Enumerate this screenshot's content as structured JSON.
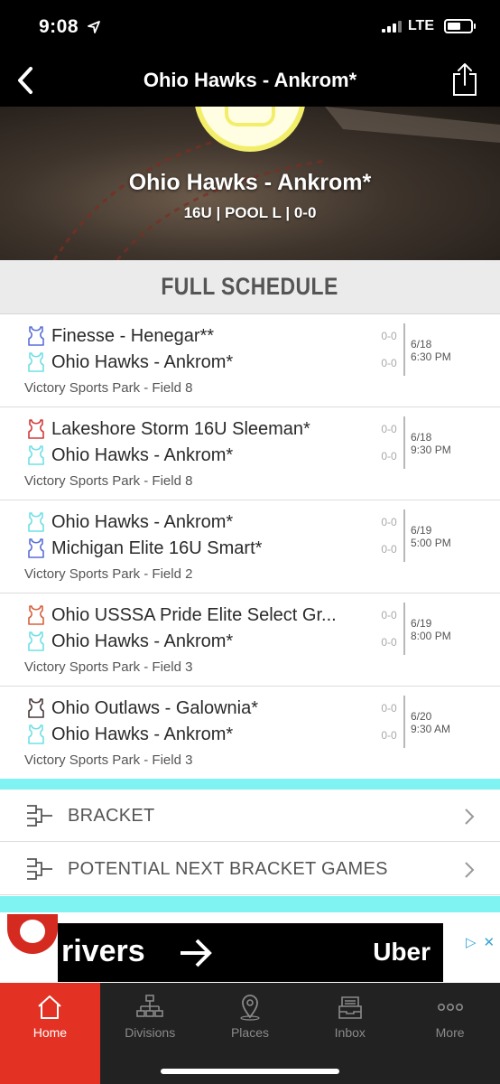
{
  "status_bar": {
    "time": "9:08",
    "network": "LTE"
  },
  "nav": {
    "title": "Ohio Hawks - Ankrom*"
  },
  "hero": {
    "team_name": "Ohio Hawks - Ankrom*",
    "meta": "16U | POOL L | 0-0"
  },
  "schedule": {
    "heading": "FULL SCHEDULE",
    "games": [
      {
        "team1": {
          "name": "Finesse - Henegar**",
          "score": "0-0",
          "jersey_color": "#5a6fd6"
        },
        "team2": {
          "name": "Ohio Hawks - Ankrom*",
          "score": "0-0",
          "jersey_color": "#6fe0e6"
        },
        "date": "6/18",
        "time": "6:30 PM",
        "venue": "Victory Sports Park - Field 8"
      },
      {
        "team1": {
          "name": "Lakeshore Storm 16U Sleeman*",
          "score": "0-0",
          "jersey_color": "#d23a3a"
        },
        "team2": {
          "name": "Ohio Hawks - Ankrom*",
          "score": "0-0",
          "jersey_color": "#6fe0e6"
        },
        "date": "6/18",
        "time": "9:30 PM",
        "venue": "Victory Sports Park - Field 8"
      },
      {
        "team1": {
          "name": "Ohio Hawks - Ankrom*",
          "score": "0-0",
          "jersey_color": "#6fe0e6"
        },
        "team2": {
          "name": "Michigan Elite 16U Smart*",
          "score": "0-0",
          "jersey_color": "#5a6fd6"
        },
        "date": "6/19",
        "time": "5:00 PM",
        "venue": "Victory Sports Park - Field 2"
      },
      {
        "team1": {
          "name": "Ohio USSSA Pride Elite Select Gr...",
          "score": "0-0",
          "jersey_color": "#d8603c"
        },
        "team2": {
          "name": "Ohio Hawks - Ankrom*",
          "score": "0-0",
          "jersey_color": "#6fe0e6"
        },
        "date": "6/19",
        "time": "8:00 PM",
        "venue": "Victory Sports Park - Field 3"
      },
      {
        "team1": {
          "name": "Ohio Outlaws - Galownia*",
          "score": "0-0",
          "jersey_color": "#4a3a3a"
        },
        "team2": {
          "name": "Ohio Hawks - Ankrom*",
          "score": "0-0",
          "jersey_color": "#6fe0e6"
        },
        "date": "6/20",
        "time": "9:30 AM",
        "venue": "Victory Sports Park - Field 3"
      }
    ]
  },
  "links": {
    "bracket": "BRACKET",
    "potential": "POTENTIAL NEXT BRACKET GAMES"
  },
  "ad": {
    "text": "rivers",
    "brand": "Uber"
  },
  "tabs": [
    {
      "label": "Home",
      "icon": "home-icon",
      "active": true
    },
    {
      "label": "Divisions",
      "icon": "divisions-icon",
      "active": false
    },
    {
      "label": "Places",
      "icon": "places-icon",
      "active": false
    },
    {
      "label": "Inbox",
      "icon": "inbox-icon",
      "active": false
    },
    {
      "label": "More",
      "icon": "more-icon",
      "active": false
    }
  ],
  "colors": {
    "accent": "#e33224",
    "cyan": "#7ff2f2",
    "tab_bg": "#222222"
  }
}
